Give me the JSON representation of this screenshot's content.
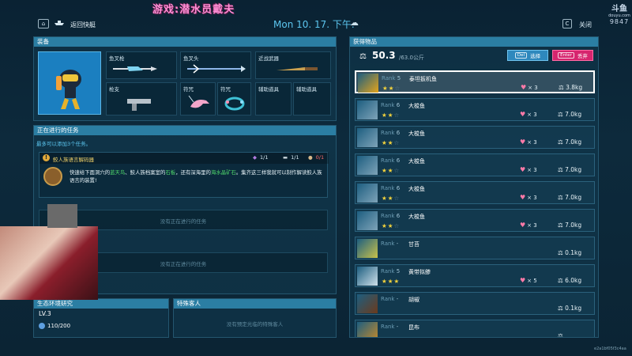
{
  "header": {
    "back_key": "⌂",
    "back_label": "返回快艇",
    "datetime": "Mon 10. 17. 下午.",
    "weather_icon": "☁",
    "close_key": "C",
    "close_label": "关闭",
    "stream_title": "游戏:潜水员戴夫",
    "logo_line1": "斗鱼",
    "logo_line2": "douyu.com",
    "logo_line3": "9847"
  },
  "equipment": {
    "title": "装备",
    "slots": [
      {
        "label": "鱼叉枪",
        "icon": "harpoon-gun-icon"
      },
      {
        "label": "鱼叉头",
        "icon": "harpoon-head-icon"
      },
      {
        "label": "近战武器",
        "icon": "knife-icon"
      },
      {
        "label": "枪支",
        "icon": "pistol-icon"
      },
      {
        "label": "符咒",
        "icon": "dolphin-charm-icon"
      },
      {
        "label": "符咒",
        "icon": "bracelet-charm-icon"
      },
      {
        "label": "辅助道具",
        "icon": ""
      },
      {
        "label": "辅助道具",
        "icon": ""
      }
    ]
  },
  "quests": {
    "title": "正在进行的任务",
    "subtitle": "最多可以添加3个任务。",
    "active": {
      "title": "鲛人族语言解码器",
      "count1": "1/1",
      "count2": "1/1",
      "count3": "0/1",
      "desc_parts": [
        {
          "text": "快速给下面洞穴的",
          "hl": false
        },
        {
          "text": "蓝天鸟",
          "hl": true
        },
        {
          "text": "、鲛人族档案室的",
          "hl": false
        },
        {
          "text": "石板",
          "hl": true
        },
        {
          "text": "，还有深海里的",
          "hl": false
        },
        {
          "text": "海水晶矿石",
          "hl": true
        },
        {
          "text": "。集齐这三样我就可以制作解读鲛人族语言的装置!",
          "hl": false
        }
      ]
    },
    "empty_text_1": "没有正在进行的任务",
    "empty_text_2": "没有正在进行的任务"
  },
  "ecology": {
    "title": "生态环境研究",
    "level": "LV.3",
    "progress_text": "110/200",
    "progress_fraction": 0.55
  },
  "guests": {
    "title": "特殊客人",
    "empty_text": "没有预定光临的特殊客人"
  },
  "inventory": {
    "title": "获得物品",
    "weight_icon": "⚖",
    "weight_current": "50.3",
    "weight_max": "/63.0公斤",
    "select_key": "Del",
    "select_label": "选择",
    "discard_key": "Enter",
    "discard_label": "丢弃",
    "items": [
      {
        "rank_prefix": "Rank",
        "rank": "5",
        "name": "泰坦扳机鱼",
        "stars": 2,
        "count": "× 3",
        "weight_icon": "⚖",
        "weight": "3.8kg",
        "thumb_color": "#e3a41c",
        "selected": true
      },
      {
        "rank_prefix": "Rank",
        "rank": "6",
        "name": "大梭鱼",
        "stars": 2,
        "count": "× 3",
        "weight_icon": "⚖",
        "weight": "7.0kg",
        "thumb_color": "#7ea3b8",
        "selected": false
      },
      {
        "rank_prefix": "Rank",
        "rank": "6",
        "name": "大梭鱼",
        "stars": 2,
        "count": "× 3",
        "weight_icon": "⚖",
        "weight": "7.0kg",
        "thumb_color": "#7ea3b8",
        "selected": false
      },
      {
        "rank_prefix": "Rank",
        "rank": "6",
        "name": "大梭鱼",
        "stars": 2,
        "count": "× 3",
        "weight_icon": "⚖",
        "weight": "7.0kg",
        "thumb_color": "#7ea3b8",
        "selected": false
      },
      {
        "rank_prefix": "Rank",
        "rank": "6",
        "name": "大梭鱼",
        "stars": 2,
        "count": "× 3",
        "weight_icon": "⚖",
        "weight": "7.0kg",
        "thumb_color": "#7ea3b8",
        "selected": false
      },
      {
        "rank_prefix": "Rank",
        "rank": "6",
        "name": "大梭鱼",
        "stars": 2,
        "count": "× 3",
        "weight_icon": "⚖",
        "weight": "7.0kg",
        "thumb_color": "#7ea3b8",
        "selected": false
      },
      {
        "rank_prefix": "Rank",
        "rank": "-",
        "name": "甘苔",
        "stars": 0,
        "count": "",
        "weight_icon": "⚖",
        "weight": "0.1kg",
        "thumb_color": "#c9c24a",
        "selected": false
      },
      {
        "rank_prefix": "Rank",
        "rank": "5",
        "name": "黄带拟鲹",
        "stars": 3,
        "count": "× 5",
        "weight_icon": "⚖",
        "weight": "6.0kg",
        "thumb_color": "#cfe0ea",
        "selected": false
      },
      {
        "rank_prefix": "Rank",
        "rank": "-",
        "name": "胡椒",
        "stars": 0,
        "count": "",
        "weight_icon": "⚖",
        "weight": "0.1kg",
        "thumb_color": "#6b3a1c",
        "selected": false
      },
      {
        "rank_prefix": "Rank",
        "rank": "-",
        "name": "昆布",
        "stars": 0,
        "count": "",
        "weight_icon": "⚖",
        "weight": "",
        "thumb_color": "#c68a2a",
        "selected": false
      }
    ]
  },
  "watermark": "e2a1bf05f3c4aa"
}
